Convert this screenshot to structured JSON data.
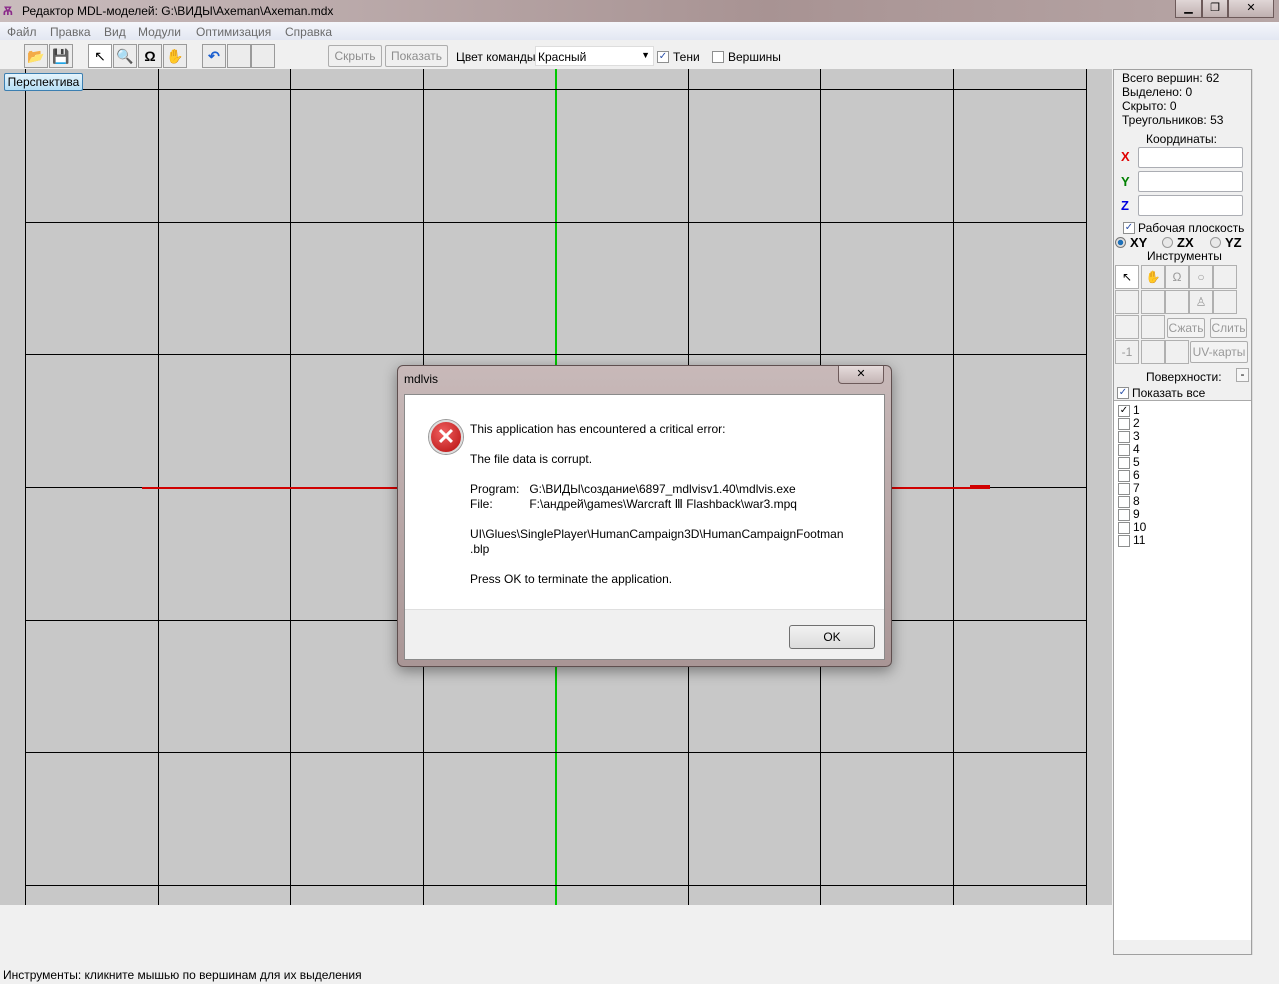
{
  "window": {
    "title": "Редактор MDL-моделей: G:\\ВИДЫ\\Axeman\\Axeman.mdx",
    "minimize": "▁",
    "maximize": "❐",
    "close": "✕"
  },
  "menu": [
    "Файл",
    "Правка",
    "Вид",
    "Модули",
    "Оптимизация",
    "Справка"
  ],
  "toolbar": {
    "hide": "Скрыть",
    "show": "Показать",
    "team_color_label": "Цвет команды:",
    "team_color_value": "Красный",
    "shadows": "Тени",
    "shadows_checked": true,
    "vertices": "Вершины",
    "vertices_checked": false
  },
  "viewport": {
    "label": "Перспектива"
  },
  "panel": {
    "total_vertices": "Всего вершин: 62",
    "selected": "Выделено: 0",
    "hidden": "Скрыто: 0",
    "triangles": "Треугольников: 53",
    "coords_label": "Координаты:",
    "x": "X",
    "y": "Y",
    "z": "Z",
    "work_plane": "Рабочая плоскость",
    "planes": [
      "XY",
      "ZX",
      "YZ"
    ],
    "plane_selected": "XY",
    "tools_label": "Инструменты",
    "compress": "Сжать",
    "merge": "Слить",
    "minus_one": "-1",
    "uv_maps": "UV-карты",
    "surfaces_label": "Поверхности:",
    "surfaces_collapse": "-",
    "show_all": "Показать все",
    "surfaces": [
      {
        "label": "1",
        "checked": true
      },
      {
        "label": "2",
        "checked": false
      },
      {
        "label": "3",
        "checked": false
      },
      {
        "label": "4",
        "checked": false
      },
      {
        "label": "5",
        "checked": false
      },
      {
        "label": "6",
        "checked": false
      },
      {
        "label": "7",
        "checked": false
      },
      {
        "label": "8",
        "checked": false
      },
      {
        "label": "9",
        "checked": false
      },
      {
        "label": "10",
        "checked": false
      },
      {
        "label": "11",
        "checked": false
      }
    ]
  },
  "status": "Инструменты: кликните мышью по вершинам для их выделения",
  "dialog": {
    "title": "mdlvis",
    "close": "✕",
    "line1": "This application has encountered a critical error:",
    "line2": "The file data is corrupt.",
    "program": "Program:   G:\\ВИДЫ\\создание\\6897_mdlvisv1.40\\mdlvis.exe",
    "file": "File:           F:\\андрей\\games\\Warcraft Ⅲ Flashback\\war3.mpq",
    "path1": "UI\\Glues\\SinglePlayer\\HumanCampaign3D\\HumanCampaignFootman",
    "path2": ".blp",
    "line3": "Press OK to terminate the application.",
    "ok": "OK"
  }
}
